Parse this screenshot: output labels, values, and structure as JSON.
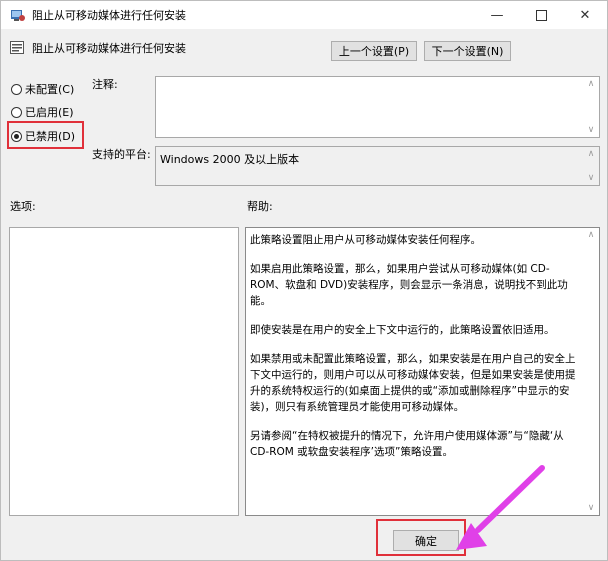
{
  "window": {
    "title": "阻止从可移动媒体进行任何安装",
    "min_icon": "minimize-icon",
    "max_icon": "maximize-icon",
    "close_icon": "close-icon"
  },
  "header": {
    "title": "阻止从可移动媒体进行任何安装",
    "prev_label": "上一个设置(P)",
    "next_label": "下一个设置(N)"
  },
  "options": {
    "not_configured": "未配置(C)",
    "enabled": "已启用(E)",
    "disabled": "已禁用(D)",
    "selected": "disabled"
  },
  "comment": {
    "label": "注释:",
    "value": ""
  },
  "platform": {
    "label": "支持的平台:",
    "value": "Windows 2000 及以上版本"
  },
  "sections": {
    "options_label": "选项:",
    "help_label": "帮助:"
  },
  "help": {
    "paragraphs": [
      "此策略设置阻止用户从可移动媒体安装任何程序。",
      "如果启用此策略设置，那么，如果用户尝试从可移动媒体(如 CD-ROM、软盘和 DVD)安装程序，则会显示一条消息，说明找不到此功能。",
      "即使安装是在用户的安全上下文中运行的，此策略设置依旧适用。",
      "如果禁用或未配置此策略设置，那么，如果安装是在用户自己的安全上下文中运行的，则用户可以从可移动媒体安装，但是如果安装是使用提升的系统特权运行的(如桌面上提供的或“添加或删除程序”中显示的安装)，则只有系统管理员才能使用可移动媒体。",
      "另请参阅“在特权被提升的情况下，允许用户使用媒体源”与“隐藏‘从 CD-ROM 或软盘安装程序’选项”策略设置。"
    ]
  },
  "footer": {
    "ok_label": "确定"
  },
  "colors": {
    "highlight": "#e0303a",
    "arrow": "#e040e8"
  }
}
